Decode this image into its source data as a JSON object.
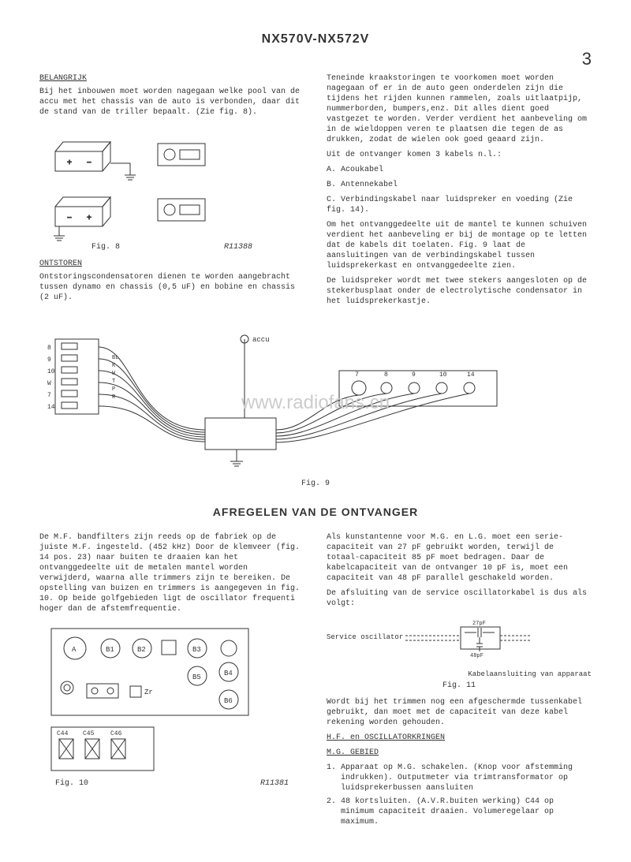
{
  "header": {
    "title": "NX570V-NX572V",
    "page_number": "3"
  },
  "col_left_1": {
    "section_label": "BELANGRIJK",
    "p1": "Bij het inbouwen moet worden nagegaan welke pool van de accu met het chassis van de auto is verbonden, daar dit de stand van de triller bepaalt. (Zie fig. 8).",
    "fig8_caption_left": "Fig. 8",
    "fig8_caption_right": "R11388",
    "section_label2": "ONTSTOREN",
    "p2": "Ontstoringscondensatoren dienen te worden aangebracht tussen dynamo en chassis (0,5 uF) en bobine en chassis (2 uF)."
  },
  "col_right_1": {
    "p1": "Teneinde kraakstoringen te voorkomen moet worden nagegaan of er in de auto geen onderdelen zijn die tijdens het rijden kunnen rammelen, zoals uitlaatpijp, nummerborden, bumpers,enz. Dit alles dient goed vastgezet te worden. Verder verdient het aanbeveling om in de wieldoppen veren te plaatsen die tegen de as drukken, zodat de wielen ook goed geaard zijn.",
    "p2": "Uit de ontvanger komen 3 kabels n.l.:",
    "list_a": "A. Acoukabel",
    "list_b": "B. Antennekabel",
    "list_c": "C. Verbindingskabel naar luidspreker en voeding (Zie fig. 14).",
    "p3": "Om het ontvanggedeelte uit de mantel te kunnen schuiven verdient het aanbeveling er bij de montage op te letten dat de kabels dit toelaten. Fig. 9 laat de aansluitingen van de verbindingskabel tussen luidsprekerkast en ontvanggedeelte zien.",
    "p4": "De luidspreker wordt met twee stekers aangesloten op de stekerbusplaat onder de electrolytische condensator in het luidsprekerkastje."
  },
  "fig9": {
    "caption": "Fig. 9",
    "accu_label": "accu",
    "terminals_left": [
      "8",
      "9",
      "10",
      "W",
      "7",
      "14"
    ],
    "wire_colors": [
      "BL",
      "K",
      "W",
      "T",
      "P",
      "R"
    ]
  },
  "section2_title": "AFREGELEN VAN DE ONTVANGER",
  "col_left_2": {
    "p1": "De M.F. bandfilters zijn reeds op de fabriek op de juiste M.F. ingesteld. (452 kHz) Door de klemveer (fig. 14 pos. 23) naar buiten te draaien kan het ontvanggedeelte uit de metalen mantel worden verwijderd, waarna alle trimmers zijn te bereiken. De opstelling van buizen en trimmers is aangegeven in fig. 10. Op beide golfgebieden ligt de oscillator frequenti hoger dan de afstemfrequentie.",
    "fig10_labels": {
      "A": "A",
      "B1": "B1",
      "B2": "B2",
      "B3": "B3",
      "B4": "B4",
      "B5": "B5",
      "B6": "B6",
      "Zr": "Zr",
      "C44": "C44",
      "C45": "C45",
      "C46": "C46"
    },
    "fig10_caption": "Fig. 10",
    "fig10_ref": "R11381"
  },
  "col_right_2": {
    "p1": "Als kunstantenne voor M.G. en L.G. moet een serie-capaciteit van 27 pF gebruikt worden, terwijl de totaal-capaciteit 85 pF moet bedragen. Daar de kabelcapaciteit van de ontvanger 10 pF is, moet een capaciteit van 48 pF parallel geschakeld worden.",
    "p2": "De afsluiting van de service oscillatorkabel is dus als volgt:",
    "fig11_label_left": "Service oscillator",
    "fig11_cap1": "27pF",
    "fig11_cap2": "48pF",
    "fig11_label_right": "Kabelaansluiting van apparaat",
    "fig11_caption": "Fig. 11",
    "p3": "Wordt bij het trimmen nog een afgeschermde tussenkabel gebruikt, dan moet met de capaciteit van deze kabel rekening worden gehouden.",
    "sub1": "H.F. en OSCILLATORKRINGEN",
    "sub2": "M.G. GEBIED",
    "li1": "Apparaat op M.G. schakelen. (Knop voor afstemming indrukken). Outputmeter via trimtransformator op luidsprekerbussen aansluiten",
    "li2": "48 kortsluiten. (A.V.R.buiten werking) C44 op minimum capaciteit draaien. Volumeregelaar op maximum."
  },
  "watermark": "www.radiofans.cn"
}
